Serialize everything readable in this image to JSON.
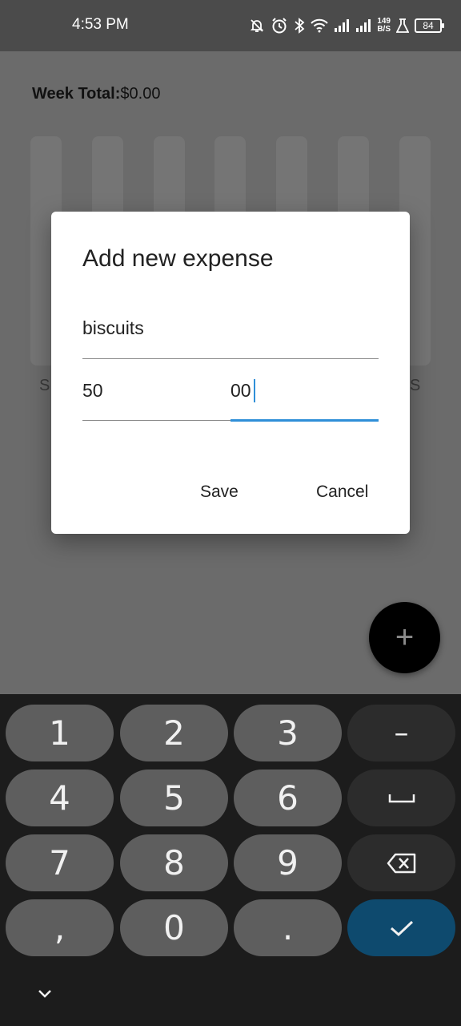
{
  "status_bar": {
    "time": "4:53 PM",
    "net_speed_value": "149",
    "net_speed_unit": "B/S",
    "battery_level": "84",
    "icons": [
      "muted-bell-icon",
      "alarm-icon",
      "bluetooth-icon",
      "wifi-icon",
      "signal-icon",
      "signal-icon-2",
      "flask-icon",
      "battery-icon"
    ]
  },
  "app": {
    "week_total_label": "Week Total:",
    "week_total_value": "$0.00",
    "chart_day_first": "S",
    "chart_day_last": "S",
    "fab_icon": "plus-icon",
    "fab_label": "+"
  },
  "dialog": {
    "title": "Add new expense",
    "name_value": "biscuits",
    "amount_whole_value": "50",
    "amount_cents_value": "00",
    "save_label": "Save",
    "cancel_label": "Cancel"
  },
  "keyboard": {
    "keys": {
      "k1": "1",
      "k2": "2",
      "k3": "3",
      "minus": "–",
      "k4": "4",
      "k5": "5",
      "k6": "6",
      "k7": "7",
      "k8": "8",
      "k9": "9",
      "comma": ",",
      "k0": "0",
      "period": "."
    },
    "icons": [
      "space-icon",
      "backspace-icon",
      "checkmark-icon",
      "chevron-down-icon"
    ]
  },
  "colors": {
    "accent": "#2f8fd8",
    "fab_background": "#000000",
    "confirm_key": "#0e4a6e",
    "scrim": "#6b6b6b"
  }
}
